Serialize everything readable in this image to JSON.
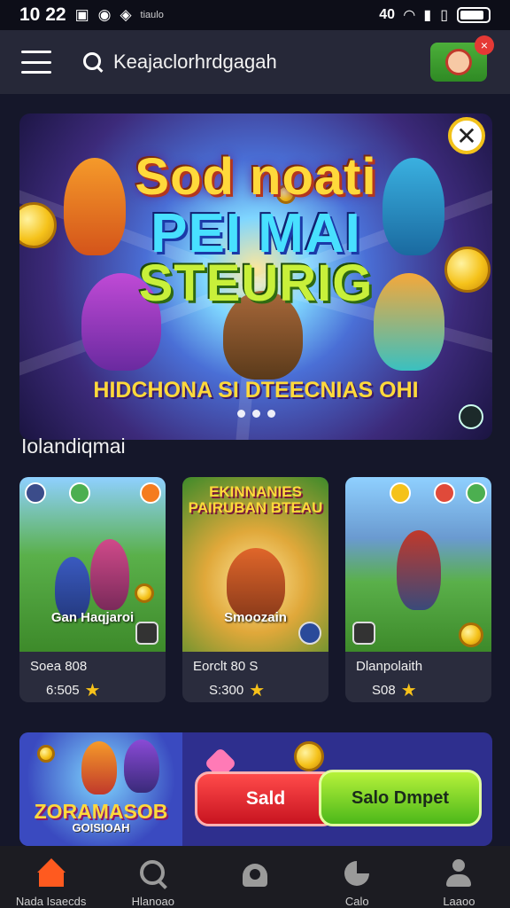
{
  "status_bar": {
    "time": "10 22",
    "tiny_text": "tiaulo",
    "signal_text": "40"
  },
  "header": {
    "search_text": "Keajaclorhrdgagah",
    "notification_badge": "×"
  },
  "banner": {
    "title_line1": "Sod noati",
    "title_line2": "PEI MAI",
    "title_line3": "STEURIG",
    "subtitle": "HIDCHONA SI DTEECNIAS OHI",
    "close_icon": "✕",
    "active_slide": 1,
    "slide_count": 3
  },
  "section": {
    "label": "Iolandiqmai"
  },
  "cards": [
    {
      "caption": "Gan Haqjaroi",
      "title": "Soea 808",
      "meta": "6:505",
      "star": "★"
    },
    {
      "big_title": "EKINNANIES PAIRUBAN BTEAU",
      "caption": "Smoozain",
      "title": "Eorclt 80 S",
      "meta": "S:300",
      "star": "★"
    },
    {
      "title": "Dlanpolaith",
      "meta": "S08",
      "star": "★"
    }
  ],
  "promo": {
    "art_title": "ZORAMASOB",
    "art_subtitle": "GOISIOAH",
    "red_button": "Sald",
    "green_button": "Salo Dmpet"
  },
  "nav": [
    {
      "label": "Nada Isaecds",
      "icon": "home-icon"
    },
    {
      "label": "Hlanoao",
      "icon": "search-icon"
    },
    {
      "label": "",
      "icon": "bag-icon"
    },
    {
      "label": "Calo",
      "icon": "chart-icon"
    },
    {
      "label": "Laaoo",
      "icon": "person-icon"
    }
  ],
  "colors": {
    "background": "#15172a",
    "header": "#262838",
    "card": "#2a2c3d",
    "accent_orange": "#ff5a1f",
    "gold": "#f7c21a"
  }
}
